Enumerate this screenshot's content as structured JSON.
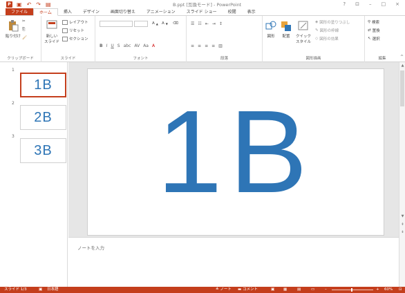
{
  "window": {
    "title": "B.ppt [互換モード] - PowerPoint",
    "controls": [
      "?",
      "□",
      "–",
      "□",
      "×"
    ]
  },
  "qat": {
    "save_icon": "save-icon",
    "undo_icon": "undo-icon",
    "redo_icon": "redo-icon",
    "start_icon": "start-from-beginning-icon"
  },
  "tabs": [
    {
      "label": "ファイル",
      "kind": "file"
    },
    {
      "label": "ホーム",
      "kind": "active"
    },
    {
      "label": "挿入",
      "kind": "normal"
    },
    {
      "label": "デザイン",
      "kind": "normal"
    },
    {
      "label": "画面切り替え",
      "kind": "normal"
    },
    {
      "label": "アニメーション",
      "kind": "normal"
    },
    {
      "label": "スライド ショー",
      "kind": "normal"
    },
    {
      "label": "校閲",
      "kind": "normal"
    },
    {
      "label": "表示",
      "kind": "normal"
    }
  ],
  "ribbon": {
    "clipboard": {
      "label": "クリップボード",
      "paste": "貼り付け"
    },
    "slides": {
      "label": "スライド",
      "new_slide": "新しい\nスライド",
      "layout": "レイアウト",
      "reset": "リセット",
      "section": "セクション"
    },
    "font": {
      "label": "フォント",
      "size": ""
    },
    "paragraph": {
      "label": "段落"
    },
    "drawing": {
      "label": "図形描画",
      "arrange": "配置",
      "quick_styles": "クイック\nスタイル",
      "shapes": "図形",
      "fill": "図形の塗りつぶし",
      "outline": "図形の枠線",
      "effects": "図形の効果"
    },
    "editing": {
      "label": "編集",
      "find": "検索",
      "replace": "置換",
      "select": "選択"
    }
  },
  "slides": [
    {
      "num": "1",
      "text": "1B",
      "selected": true
    },
    {
      "num": "2",
      "text": "2B",
      "selected": false
    },
    {
      "num": "3",
      "text": "3B",
      "selected": false
    }
  ],
  "current_slide": {
    "text": "1B",
    "color": "#2e75b6"
  },
  "notes": {
    "placeholder": "ノートを入力"
  },
  "status": {
    "slide_pos": "スライド 1/3",
    "language": "日本語",
    "notes_btn": "ノート",
    "comments_btn": "コメント",
    "zoom": "60%"
  },
  "colors": {
    "accent": "#c43e1c",
    "slide_text": "#2e75b6"
  }
}
